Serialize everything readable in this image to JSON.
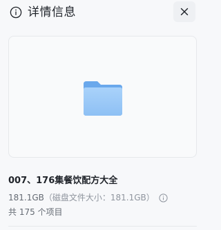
{
  "panel": {
    "title": "详情信息",
    "close_label": "×"
  },
  "file": {
    "name": "007、176集餐饮配方大全",
    "size": "181.1GB",
    "disk_size_text": "（磁盘文件大小：181.1GB）",
    "count_text": "共 175 个项目"
  },
  "colors": {
    "folder_back": "#6aa8ec",
    "folder_front": "#9cc9f7",
    "background": "#f7f8fa"
  },
  "icons": {
    "info": "info-circle-icon",
    "close": "close-icon",
    "folder": "folder-icon",
    "help": "info-circle-icon"
  }
}
